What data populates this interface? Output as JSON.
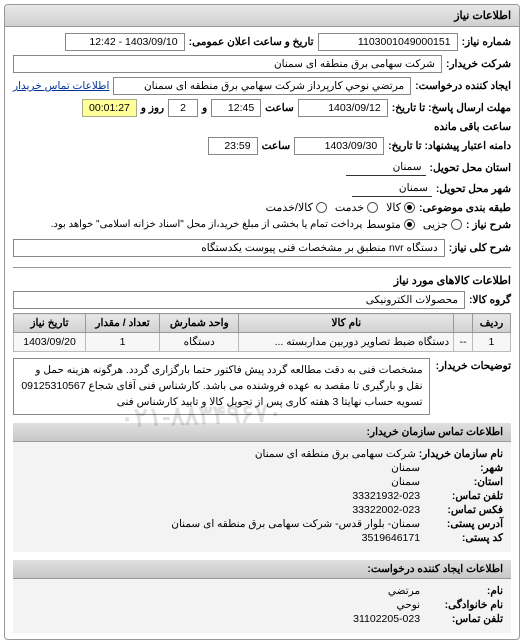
{
  "main": {
    "title": "اطلاعات نیاز",
    "request_no_label": "شماره نیاز:",
    "request_no": "1103001049000151",
    "datetime_label": "تاریخ و ساعت اعلان عمومی:",
    "datetime": "1403/09/10 - 12:42",
    "buyer_label": "شرکت خریدار:",
    "buyer": "شرکت سهامی برق منطقه ای سمنان",
    "requester_label": "ایجاد کننده درخواست:",
    "requester": "مرتضي نوحي كارپرداز شركت سهامي برق منطقه ای سمنان",
    "contact_link": "اطلاعات تماس خریدار",
    "deadline_label": "مهلت ارسال پاسخ: تا تاریخ:",
    "deadline_date": "1403/09/12",
    "deadline_time_label": "ساعت",
    "deadline_time": "12:45",
    "remain_label": "و",
    "remain_days": "2",
    "remain_days_label": "روز و",
    "remain_timer": "00:01:27",
    "remain_suffix": "ساعت باقی مانده",
    "validity_label": "دامنه اعتبار پیشنهاد: تا تاریخ:",
    "validity_date": "1403/09/30",
    "validity_time_label": "ساعت",
    "validity_time": "23:59",
    "province_label": "استان محل تحویل:",
    "province": "سمنان",
    "city_label": "شهر محل تحویل:",
    "city": "سمنان",
    "category_label": "طبقه بندی موضوعی:",
    "cat_all": "کالا",
    "cat_service": "خدمت",
    "cat_both": "کالا/خدمت",
    "size_label": "شرح نیاز :",
    "size_small": "جزیی",
    "size_medium": "متوسط",
    "size_note": "پرداخت تمام یا بخشی از مبلغ خرید،از محل \"اسناد خزانه اسلامی\" خواهد بود.",
    "need_title_label": "شرح کلی نیاز:",
    "need_title": "دستگاه nvr منطبق بر مشخصات فنی پیوست یکدستگاه"
  },
  "items": {
    "title": "اطلاعات کالاهای مورد نیاز",
    "group_label": "گروه کالا:",
    "group": "محصولات الکترونیکی",
    "headers": {
      "row": "ردیف",
      "name": "نام کالا",
      "unit": "واحد شمارش",
      "qty": "تعداد / مقدار",
      "date": "تاریخ نیاز"
    },
    "rows": [
      {
        "row": "1",
        "code": "--",
        "name": "دستگاه ضبط تصاویر دوربین مداربسته ...",
        "unit": "دستگاه",
        "qty": "1",
        "date": "1403/09/20"
      }
    ],
    "desc_label": "توضیحات خریدار:",
    "desc": "مشخصات فنی به دقت مطالعه گردد پیش فاکتور حتما بارگزاری گردد. هرگونه هزینه حمل و نقل و بارگیری تا مقصد به عهده فروشنده می باشد. کارشناس فنی آقای شجاع 09125310567 تسویه حساب نهایتا 3 هفته کاری پس از تحویل کالا و تایید کارشناس فنی"
  },
  "contact_buyer": {
    "title": "اطلاعات تماس سازمان خریدار:",
    "org_label": "نام سازمان خریدار:",
    "org": "شرکت سهامی برق منطقه ای سمنان",
    "city_label": "شهر:",
    "city": "سمنان",
    "province_label": "استان:",
    "province": "سمنان",
    "phone_label": "تلفن تماس:",
    "phone": "33321932-023",
    "fax_label": "فکس تماس:",
    "fax": "33322002-023",
    "address_label": "آدرس پستی:",
    "address": "سمنان- بلوار قدس- شرکت سهامی برق منطقه ای سمنان",
    "postcode_label": "کد پستی:",
    "postcode": "3519646171"
  },
  "contact_creator": {
    "title": "اطلاعات ایجاد کننده درخواست:",
    "fname_label": "نام:",
    "fname": "مرتضي",
    "lname_label": "نام خانوادگی:",
    "lname": "نوحي",
    "phone_label": "تلفن تماس:",
    "phone": "31102205-023"
  },
  "watermark": "۰۲۱-۸۸۳۴۹۶۷۰"
}
